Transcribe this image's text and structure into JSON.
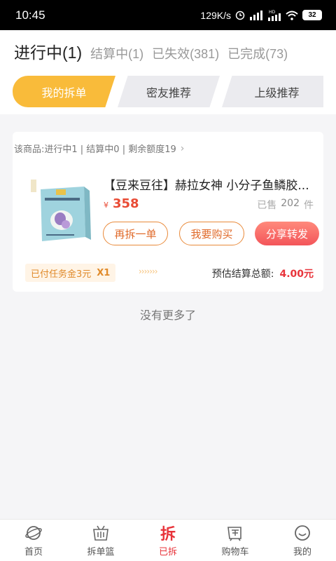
{
  "status_bar": {
    "time": "10:45",
    "speed": "129K/s",
    "battery": "32",
    "network_badge": "HD"
  },
  "status_tabs": [
    {
      "label": "进行中(1)",
      "active": true
    },
    {
      "label": "结算中(1)",
      "active": false
    },
    {
      "label": "已失效(381)",
      "active": false
    },
    {
      "label": "已完成(73)",
      "active": false
    }
  ],
  "segments": [
    {
      "label": "我的拆单",
      "active": true
    },
    {
      "label": "密友推荐",
      "active": false
    },
    {
      "label": "上级推荐",
      "active": false
    }
  ],
  "card": {
    "summary": "该商品:进行中1 | 结算中0 | 剩余额度19",
    "product_title": "【豆来豆往】赫拉女神 小分子鱼鳞胶...",
    "price_symbol": "¥",
    "price": "358",
    "sold_label": "已售",
    "sold_count": "202",
    "sold_unit": "件",
    "buttons": {
      "rebuy": "再拆一单",
      "buy": "我要购买",
      "share": "分享转发"
    },
    "task_fee": "已付任务金3元",
    "task_multiplier": "X1",
    "arrows": "›››››››",
    "estimate_label": "预估结算总额:",
    "estimate_value": "4.00元"
  },
  "no_more": "没有更多了",
  "bottom_nav": [
    {
      "label": "首页",
      "icon": "home-icon",
      "active": false
    },
    {
      "label": "拆单篮",
      "icon": "split-basket-icon",
      "active": false
    },
    {
      "label": "已拆",
      "icon": "split-icon",
      "active": true,
      "icon_text": "拆"
    },
    {
      "label": "购物车",
      "icon": "cart-icon",
      "active": false
    },
    {
      "label": "我的",
      "icon": "profile-icon",
      "active": false
    }
  ],
  "colors": {
    "accent": "#f9bb3a",
    "price_red": "#e94b35",
    "button_orange": "#e98a3a",
    "share_gradient_end": "#f3555a"
  }
}
